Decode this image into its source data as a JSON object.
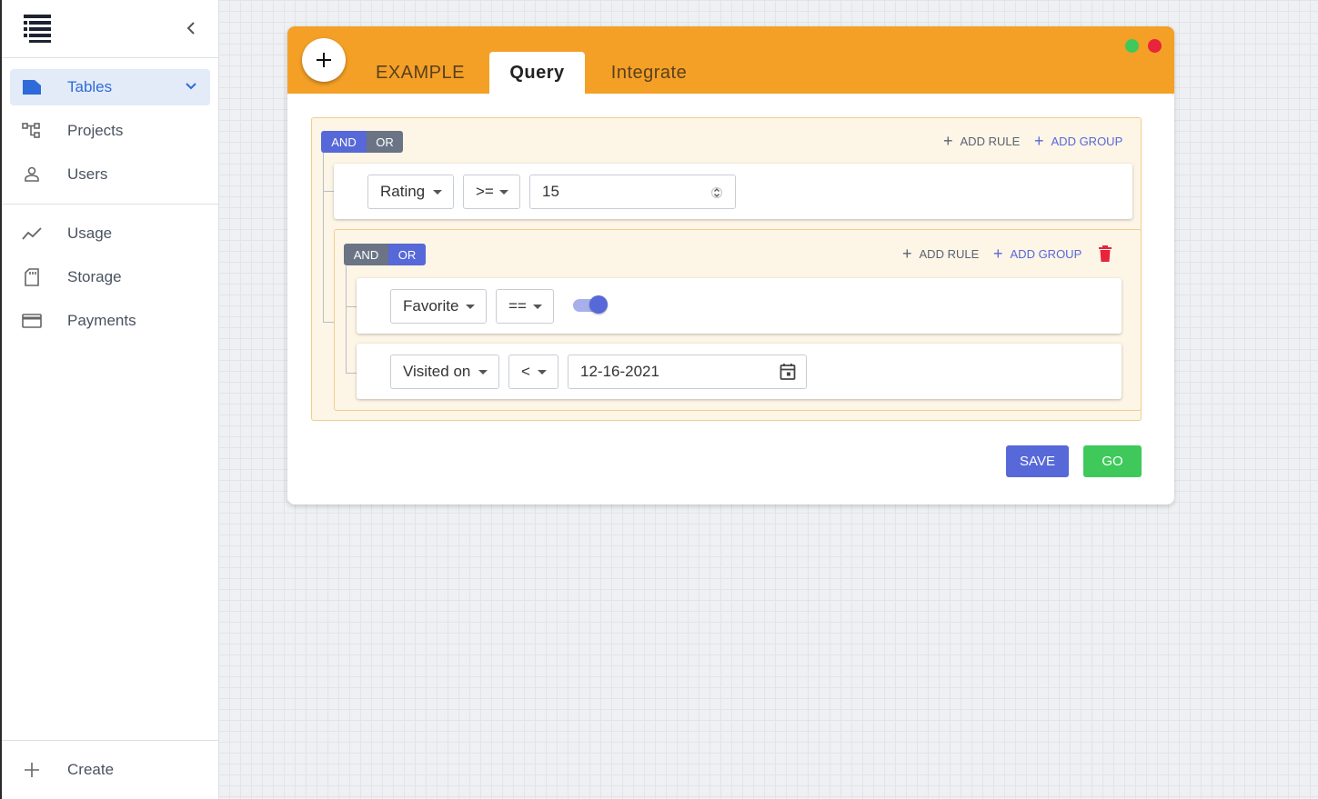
{
  "sidebar": {
    "items": [
      {
        "label": "Tables",
        "icon": "table-icon"
      },
      {
        "label": "Projects",
        "icon": "hierarchy-icon"
      },
      {
        "label": "Users",
        "icon": "user-icon"
      },
      {
        "label": "Usage",
        "icon": "line-chart-icon"
      },
      {
        "label": "Storage",
        "icon": "sd-card-icon"
      },
      {
        "label": "Payments",
        "icon": "credit-card-icon"
      }
    ],
    "create_label": "Create"
  },
  "panel": {
    "tabs": [
      "EXAMPLE",
      "Query",
      "Integrate"
    ],
    "active_tab": "Query"
  },
  "query": {
    "root": {
      "and_label": "AND",
      "or_label": "OR",
      "active_conjunction": "AND",
      "add_rule_label": "ADD RULE",
      "add_group_label": "ADD GROUP",
      "rule": {
        "field": "Rating",
        "operator": ">=",
        "value": "15"
      }
    },
    "subgroup": {
      "and_label": "AND",
      "or_label": "OR",
      "active_conjunction": "OR",
      "add_rule_label": "ADD RULE",
      "add_group_label": "ADD GROUP",
      "rules": [
        {
          "field": "Favorite",
          "operator": "==",
          "value": true
        },
        {
          "field": "Visited on",
          "operator": "<",
          "value": "12-16-2021"
        }
      ]
    }
  },
  "actions": {
    "save_label": "SAVE",
    "go_label": "GO"
  },
  "colors": {
    "header": "#f4a026",
    "primary": "#5768d8",
    "success": "#3ec95a",
    "danger": "#e8243c",
    "sidebar_active": "#2f6bd8"
  }
}
